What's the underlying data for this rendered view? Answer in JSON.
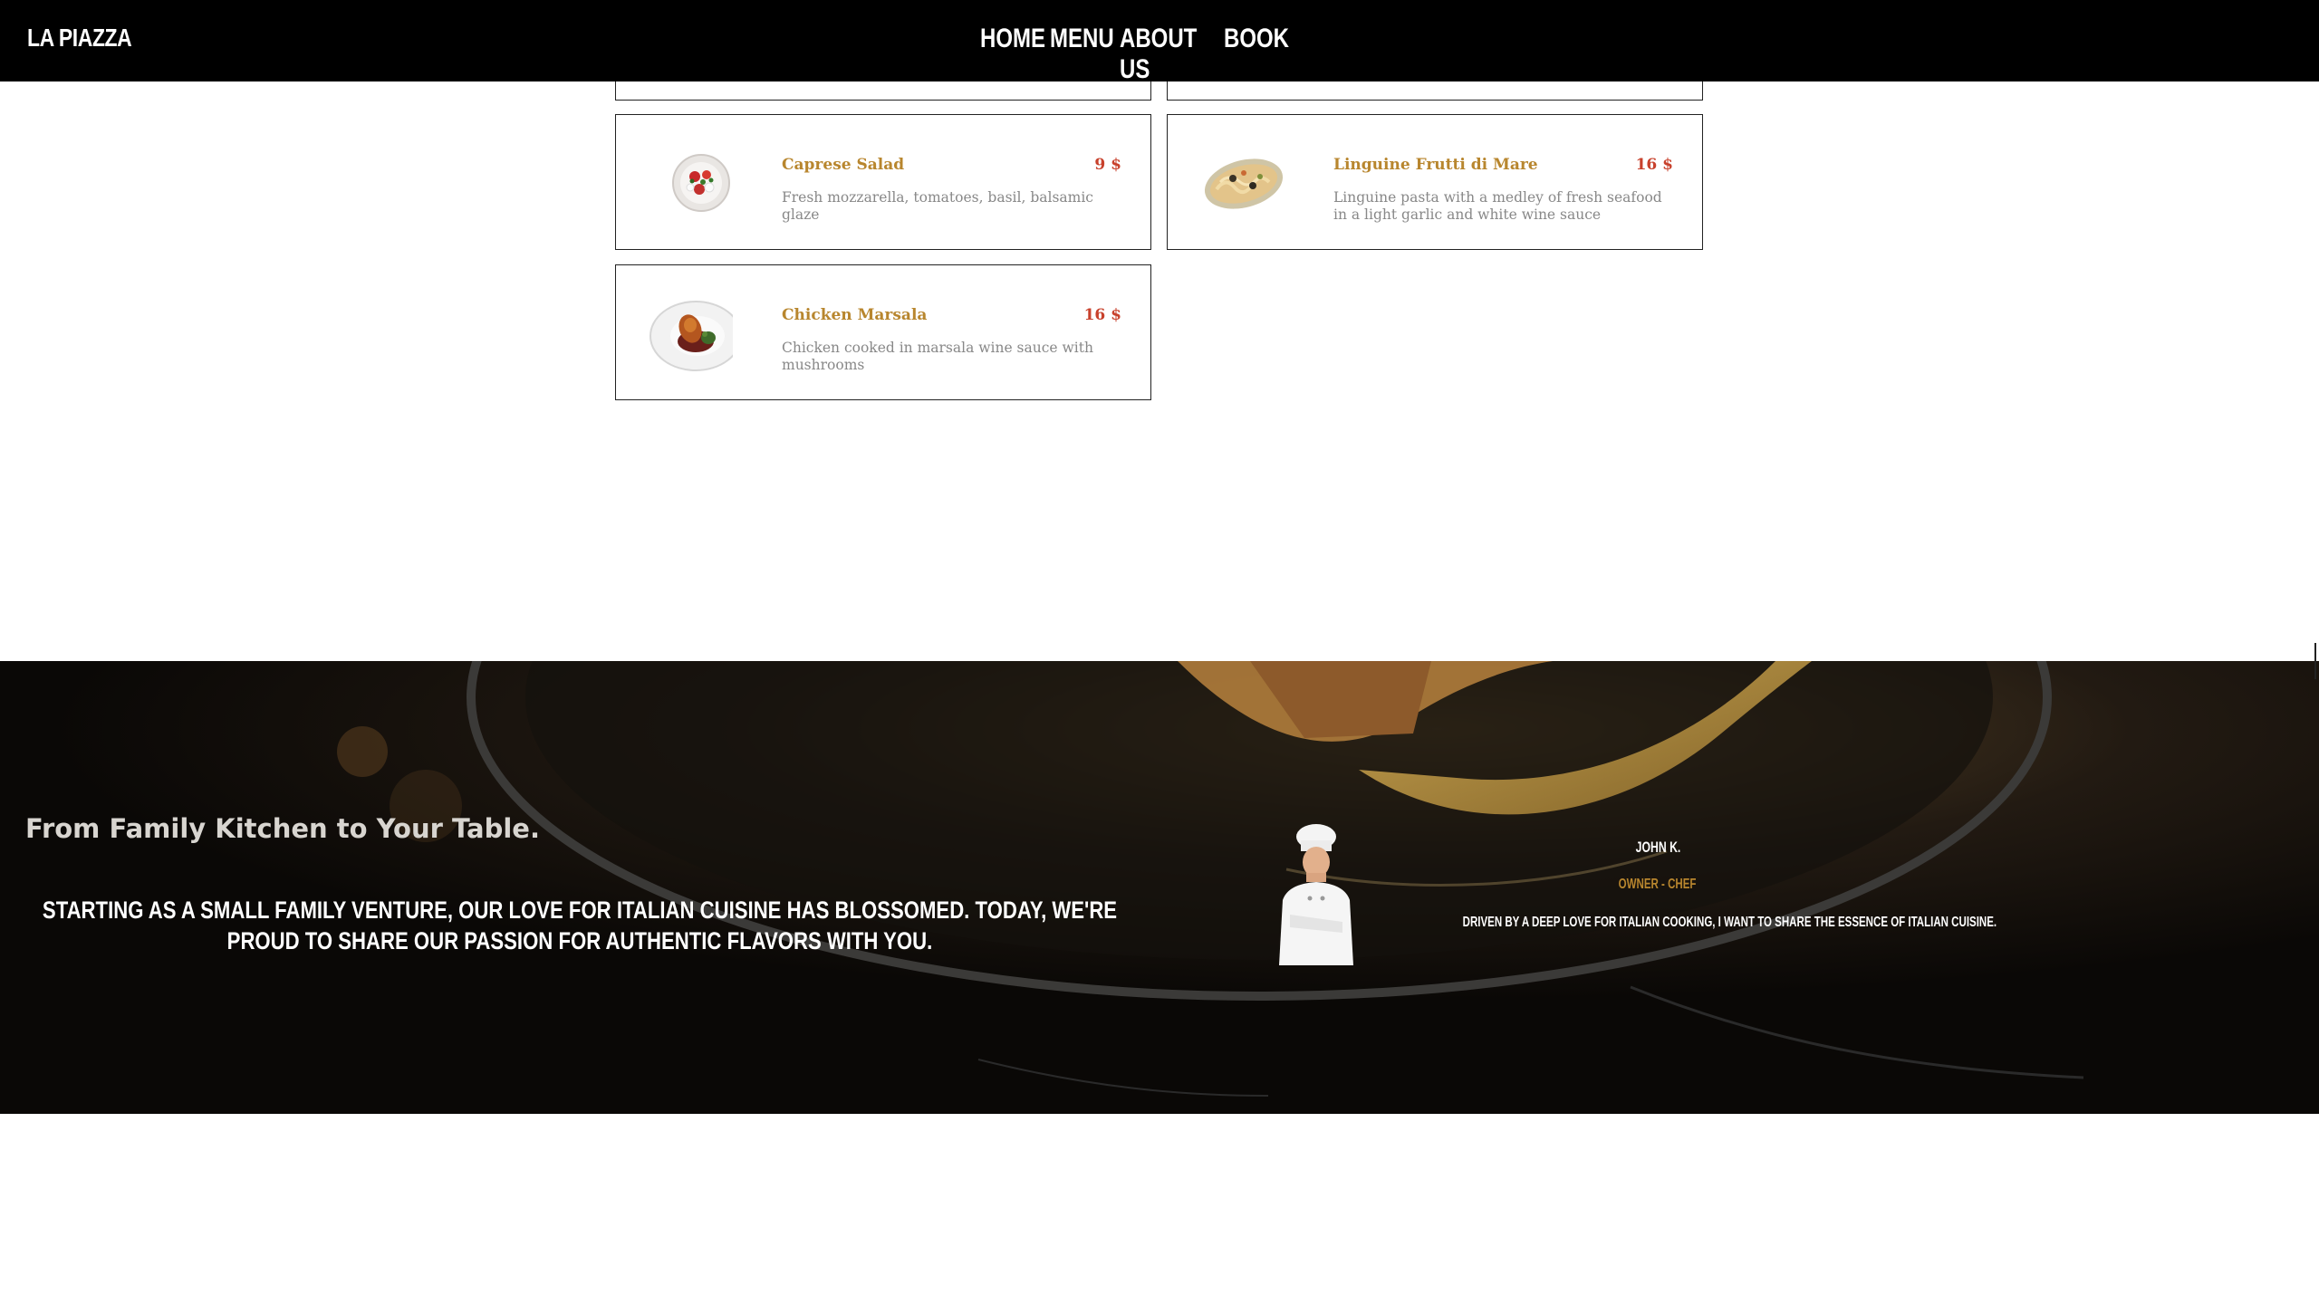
{
  "navbar": {
    "brand": "LA PIAZZA",
    "links": [
      "HOME",
      "MENU",
      "ABOUT US",
      "BOOK"
    ]
  },
  "menu": {
    "items": [
      {
        "name": "Caprese Salad",
        "price": "9 $",
        "description": "Fresh mozzarella, tomatoes, basil, balsamic glaze",
        "icon": "caprese-salad-plate"
      },
      {
        "name": "Linguine Frutti di Mare",
        "price": "16 $",
        "description": "Linguine pasta with a medley of fresh seafood in a light garlic and white wine sauce",
        "icon": "seafood-pasta-plate"
      },
      {
        "name": "Chicken Marsala",
        "price": "16 $",
        "description": "Chicken cooked in marsala wine sauce with mushrooms",
        "icon": "chicken-marsala-plate"
      }
    ]
  },
  "about": {
    "heading": "From Family Kitchen to Your Table.",
    "story": "Starting as a small family venture, our love for Italian cuisine has blossomed. Today, we're proud to share our passion for authentic flavors with you.",
    "chef": {
      "name": "JOHN K.",
      "role": "OWNER - CHEF",
      "quote": "Driven by a deep love for Italian cooking, I want to share the essence of Italian cuisine."
    }
  },
  "colors": {
    "accent_gold": "#b8862e",
    "price_red": "#c8412c",
    "nav_bg": "#000000"
  }
}
